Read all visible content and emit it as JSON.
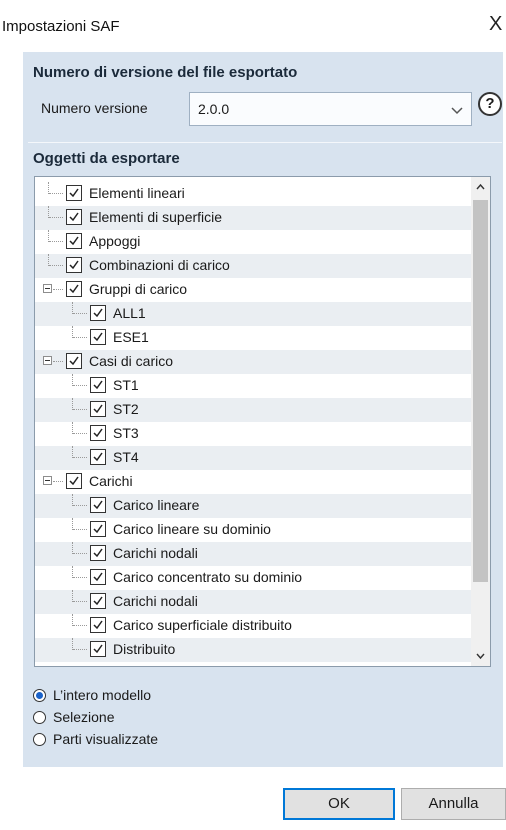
{
  "window": {
    "title": "Impostazioni SAF",
    "close_glyph": "X"
  },
  "version_section": {
    "title": "Numero di versione del file esportato",
    "label": "Numero versione",
    "selected": "2.0.0",
    "help_glyph": "?"
  },
  "objects_section": {
    "title": "Oggetti da esportare",
    "items": [
      {
        "label": "Elementi lineari",
        "level": 0,
        "checked": true
      },
      {
        "label": "Elementi di superficie",
        "level": 0,
        "checked": true
      },
      {
        "label": "Appoggi",
        "level": 0,
        "checked": true
      },
      {
        "label": "Combinazioni di carico",
        "level": 0,
        "checked": true
      },
      {
        "label": "Gruppi di carico",
        "level": 0,
        "checked": true,
        "expanded": true
      },
      {
        "label": "ALL1",
        "level": 1,
        "checked": true
      },
      {
        "label": "ESE1",
        "level": 1,
        "checked": true
      },
      {
        "label": "Casi di carico",
        "level": 0,
        "checked": true,
        "expanded": true
      },
      {
        "label": "ST1",
        "level": 1,
        "checked": true
      },
      {
        "label": "ST2",
        "level": 1,
        "checked": true
      },
      {
        "label": "ST3",
        "level": 1,
        "checked": true
      },
      {
        "label": "ST4",
        "level": 1,
        "checked": true
      },
      {
        "label": "Carichi",
        "level": 0,
        "checked": true,
        "expanded": true
      },
      {
        "label": "Carico lineare",
        "level": 1,
        "checked": true
      },
      {
        "label": "Carico lineare su dominio",
        "level": 1,
        "checked": true
      },
      {
        "label": "Carichi nodali",
        "level": 1,
        "checked": true
      },
      {
        "label": "Carico concentrato su dominio",
        "level": 1,
        "checked": true
      },
      {
        "label": "Carichi nodali",
        "level": 1,
        "checked": true
      },
      {
        "label": "Carico superficiale distribuito",
        "level": 1,
        "checked": true
      },
      {
        "label": "Distribuito",
        "level": 1,
        "checked": true
      }
    ]
  },
  "scope": {
    "options": [
      {
        "label": "L’intero modello",
        "selected": true
      },
      {
        "label": "Selezione",
        "selected": false
      },
      {
        "label": "Parti visualizzate",
        "selected": false
      }
    ]
  },
  "buttons": {
    "ok": "OK",
    "cancel": "Annulla"
  },
  "colors": {
    "panel_bg": "#d8e3ef",
    "radio_accent": "#1a62c9",
    "default_button_border": "#0078d7"
  },
  "icons": [
    "close-icon",
    "chevron-down-icon",
    "help-icon",
    "check-icon",
    "collapse-icon",
    "scroll-up-icon",
    "scroll-down-icon"
  ]
}
